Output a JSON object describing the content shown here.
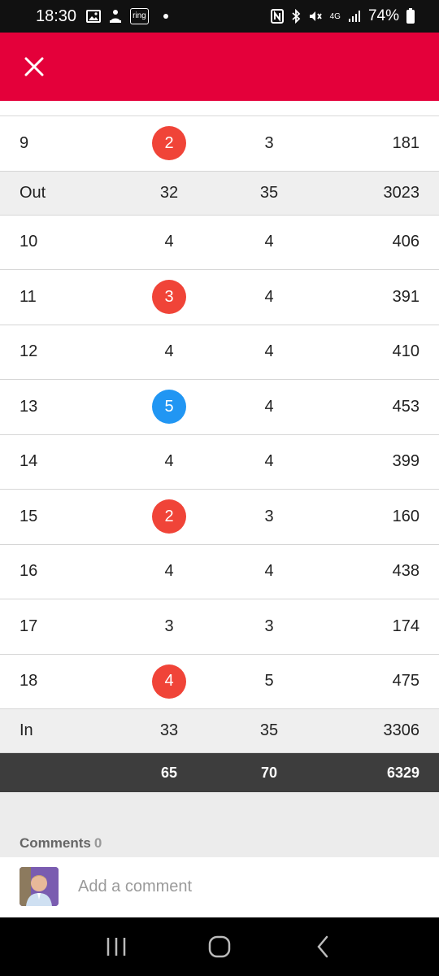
{
  "status_bar": {
    "time": "18:30",
    "left_icons": [
      "image-icon",
      "notification-icon",
      "ring-icon"
    ],
    "ring_text": "ring",
    "network": "4G",
    "battery": "74%"
  },
  "app_bar": {
    "close_icon": "close-icon",
    "color": "#e4003a"
  },
  "scorecard": {
    "rows": [
      {
        "type": "hole",
        "hole": "9",
        "score": "2",
        "marker": "birdie",
        "par": "3",
        "yards": "181"
      },
      {
        "type": "subtotal",
        "hole": "Out",
        "score": "32",
        "marker": "none",
        "par": "35",
        "yards": "3023"
      },
      {
        "type": "hole",
        "hole": "10",
        "score": "4",
        "marker": "none",
        "par": "4",
        "yards": "406"
      },
      {
        "type": "hole",
        "hole": "11",
        "score": "3",
        "marker": "birdie",
        "par": "4",
        "yards": "391"
      },
      {
        "type": "hole",
        "hole": "12",
        "score": "4",
        "marker": "none",
        "par": "4",
        "yards": "410"
      },
      {
        "type": "hole",
        "hole": "13",
        "score": "5",
        "marker": "bogey",
        "par": "4",
        "yards": "453"
      },
      {
        "type": "hole",
        "hole": "14",
        "score": "4",
        "marker": "none",
        "par": "4",
        "yards": "399"
      },
      {
        "type": "hole",
        "hole": "15",
        "score": "2",
        "marker": "birdie",
        "par": "3",
        "yards": "160"
      },
      {
        "type": "hole",
        "hole": "16",
        "score": "4",
        "marker": "none",
        "par": "4",
        "yards": "438"
      },
      {
        "type": "hole",
        "hole": "17",
        "score": "3",
        "marker": "none",
        "par": "3",
        "yards": "174"
      },
      {
        "type": "hole",
        "hole": "18",
        "score": "4",
        "marker": "birdie",
        "par": "5",
        "yards": "475"
      },
      {
        "type": "subtotal",
        "hole": "In",
        "score": "33",
        "marker": "none",
        "par": "35",
        "yards": "3306"
      },
      {
        "type": "total",
        "hole": "",
        "score": "65",
        "marker": "none",
        "par": "70",
        "yards": "6329"
      }
    ],
    "colors": {
      "birdie": "#f04438",
      "bogey": "#2196f3",
      "total_bg": "#3d3d3d",
      "subtotal_bg": "#efefef"
    }
  },
  "comments": {
    "label": "Comments",
    "count": "0",
    "placeholder": "Add a comment"
  },
  "nav_bar": {
    "icons": [
      "recent-apps-icon",
      "home-icon",
      "back-icon"
    ]
  }
}
